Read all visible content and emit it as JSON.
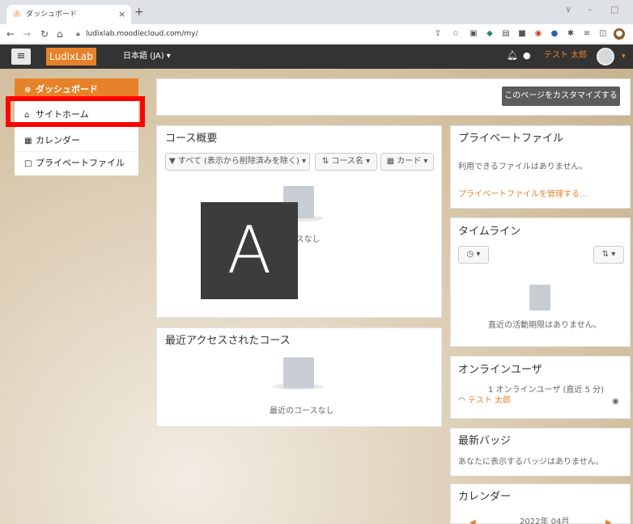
{
  "browser": {
    "tab_title": "ダッシュボード",
    "tab_close": "×",
    "new_tab": "+",
    "url": "ludixlab.moodlecloud.com/my/",
    "win_min": "–",
    "win_max": "□",
    "win_chev": "∨"
  },
  "navbar": {
    "brand": "LudixLab",
    "language": "日本語 (JA) ▾",
    "user_name": "テスト 太郎"
  },
  "sidebar": {
    "items": [
      {
        "label": "ダッシュボード",
        "icon": "dashboard-icon"
      },
      {
        "label": "サイトホーム",
        "icon": "home-icon"
      },
      {
        "label": "カレンダー",
        "icon": "calendar-icon"
      },
      {
        "label": "プライベートファイル",
        "icon": "file-icon"
      }
    ]
  },
  "main": {
    "customize_button": "このページをカスタマイズする",
    "course_overview": {
      "title": "コース概要",
      "filter": "すべて (表示から削除済みを除く)",
      "sort": "コース名",
      "view": "カード",
      "empty": "コースなし"
    },
    "recent_courses": {
      "title": "最近アクセスされたコース",
      "empty": "最近のコースなし"
    }
  },
  "right": {
    "private_files": {
      "title": "プライベートファイル",
      "empty": "利用できるファイルはありません。",
      "manage_link": "プライベートファイルを管理する..."
    },
    "timeline": {
      "title": "タイムライン",
      "empty": "直近の活動期限はありません。"
    },
    "online_users": {
      "title": "オンラインユーザ",
      "count_text": "1 オンラインユーザ (直近 5 分)",
      "user": "テスト 太郎"
    },
    "badges": {
      "title": "最新バッジ",
      "empty": "あなたに表示するバッジはありません。"
    },
    "calendar": {
      "title": "カレンダー",
      "month": "2022年 04月"
    }
  },
  "overlay_letter": "A"
}
